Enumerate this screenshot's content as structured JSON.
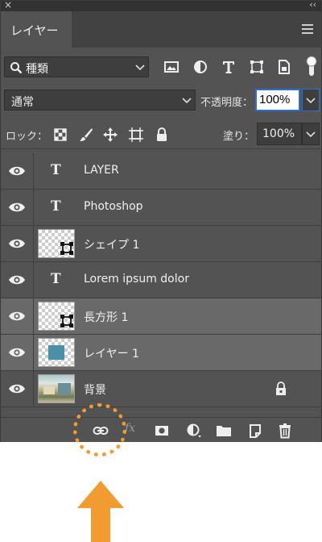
{
  "window": {
    "close_glyph": "×",
    "collapse_glyph": "‹‹"
  },
  "tab": {
    "label": "レイヤー"
  },
  "filter": {
    "kind_label": "種類",
    "icons": [
      "image-filter-icon",
      "adjustment-filter-icon",
      "type-filter-icon",
      "shape-filter-icon",
      "smart-object-filter-icon"
    ]
  },
  "blend": {
    "mode": "通常",
    "opacity_label": "不透明度：",
    "opacity_value": "100%"
  },
  "lock": {
    "label": "ロック：",
    "fill_label": "塗り：",
    "fill_value": "100%"
  },
  "layers": [
    {
      "name": "LAYER",
      "kind": "text",
      "selected": false
    },
    {
      "name": "Photoshop",
      "kind": "text",
      "selected": false
    },
    {
      "name": "シェイプ 1",
      "kind": "shape",
      "selected": false
    },
    {
      "name": "Lorem ipsum dolor",
      "kind": "text",
      "selected": false
    },
    {
      "name": "長方形 1",
      "kind": "shape",
      "selected": true
    },
    {
      "name": "レイヤー 1",
      "kind": "pixel",
      "selected": true
    },
    {
      "name": "背景",
      "kind": "background",
      "selected": false,
      "locked": true
    }
  ],
  "bottom_bar": {
    "fx_label": "fx",
    "icons": [
      "link-layers-icon",
      "fx-icon",
      "mask-icon",
      "adjustment-layer-icon",
      "group-folder-icon",
      "new-layer-icon",
      "trash-icon"
    ]
  },
  "colors": {
    "panel_bg": "#535353",
    "selected_bg": "#696969",
    "accent_blue": "#2b6fd1",
    "highlight_orange": "#f29b30",
    "layer1_fill": "#4c8fa8"
  }
}
